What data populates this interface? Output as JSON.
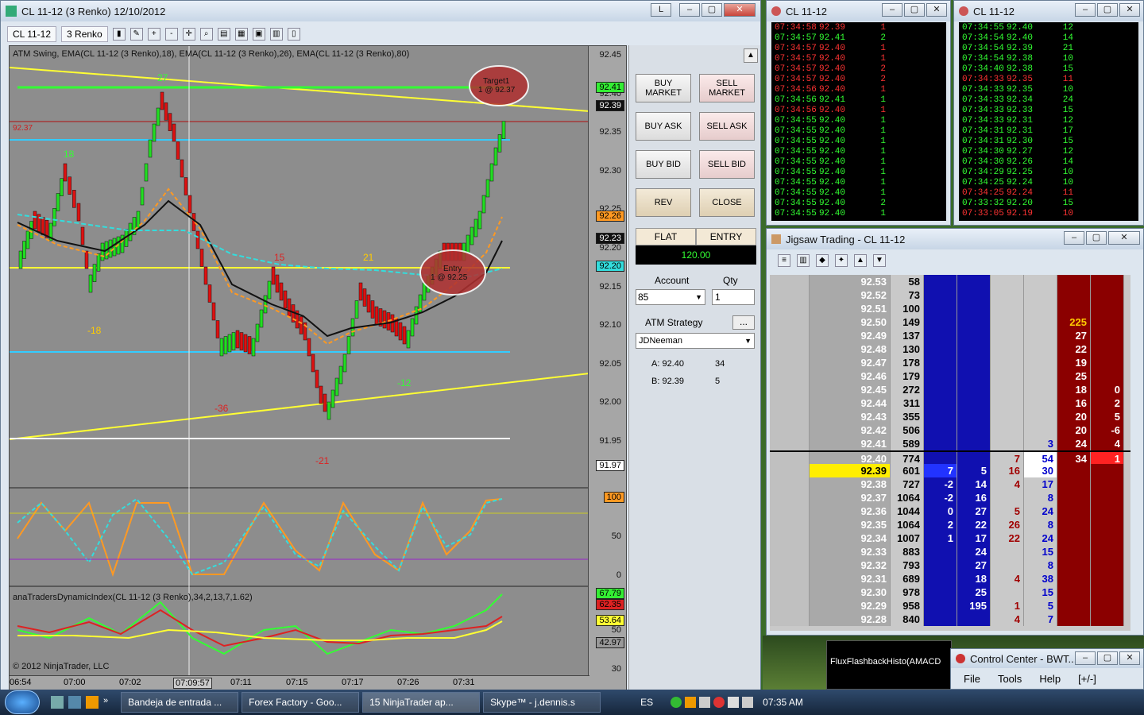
{
  "chart_window": {
    "title": "CL 11-12 (3 Renko)  12/10/2012",
    "mode_btn": "L",
    "instrument": "CL 11-12",
    "period": "3 Renko",
    "indicator_label": "ATM Swing, EMA(CL 11-12 (3 Renko),18), EMA(CL 11-12 (3 Renko),26), EMA(CL 11-12 (3 Renko),80)",
    "lower_label": "anaTradersDynamicIndex(CL 11-12 (3 Renko),34,2,13,7,1.62)",
    "copyright": "© 2012 NinjaTrader, LLC",
    "yticks": [
      "92.45",
      "92.40",
      "92.35",
      "92.30",
      "92.25",
      "92.20",
      "92.15",
      "92.10",
      "92.05",
      "92.00",
      "91.95"
    ],
    "tags": {
      "t1": "92.41",
      "t2": "92.39",
      "t3": "92.26",
      "t4": "92.23",
      "t5": "92.20",
      "t6": "91.97"
    },
    "osc_ticks": [
      "100",
      "50",
      "0"
    ],
    "tdi_ticks": [
      "90",
      "70",
      "50",
      "30"
    ],
    "tdi_tags": [
      "67.79",
      "62.35",
      "53.64",
      "42.97"
    ],
    "xticks": [
      "06:54",
      "07:00",
      "07:02",
      "07:09:57",
      "07:11",
      "07:15",
      "07:17",
      "07:26",
      "07:31"
    ],
    "swing_labels": [
      "27",
      "18",
      "-18",
      "15",
      "21",
      "-36",
      "-21",
      "-12"
    ],
    "target": "Target1",
    "target_qty": "1 @ 92.37",
    "entry": "Entry",
    "entry_qty": "1 @ 92.25",
    "left_price": "92.37"
  },
  "order_panel": {
    "buy_market": "BUY MARKET",
    "sell_market": "SELL MARKET",
    "buy_ask": "BUY ASK",
    "sell_ask": "SELL ASK",
    "buy_bid": "BUY BID",
    "sell_bid": "SELL BID",
    "rev": "REV",
    "close": "CLOSE",
    "flat": "FLAT",
    "entry": "ENTRY",
    "position": "120.00",
    "account_label": "Account",
    "qty_label": "Qty",
    "account_value": "85",
    "qty_value": "1",
    "atm_label": "ATM Strategy",
    "atm_btn": "...",
    "atm_value": "JDNeeman",
    "ask_label": "A: 92.40",
    "ask_size": "34",
    "bid_label": "B: 92.39",
    "bid_size": "5"
  },
  "ts1": {
    "title": "CL 11-12",
    "rows": [
      [
        "07:34:58",
        "92.39",
        "1",
        "r"
      ],
      [
        "07:34:57",
        "92.41",
        "2",
        "g"
      ],
      [
        "07:34:57",
        "92.40",
        "1",
        "r"
      ],
      [
        "07:34:57",
        "92.40",
        "1",
        "r"
      ],
      [
        "07:34:57",
        "92.40",
        "2",
        "r"
      ],
      [
        "07:34:57",
        "92.40",
        "2",
        "r"
      ],
      [
        "07:34:56",
        "92.40",
        "1",
        "r"
      ],
      [
        "07:34:56",
        "92.41",
        "1",
        "g"
      ],
      [
        "07:34:56",
        "92.40",
        "1",
        "r"
      ],
      [
        "07:34:55",
        "92.40",
        "1",
        "g"
      ],
      [
        "07:34:55",
        "92.40",
        "1",
        "g"
      ],
      [
        "07:34:55",
        "92.40",
        "1",
        "g"
      ],
      [
        "07:34:55",
        "92.40",
        "1",
        "g"
      ],
      [
        "07:34:55",
        "92.40",
        "1",
        "g"
      ],
      [
        "07:34:55",
        "92.40",
        "1",
        "g"
      ],
      [
        "07:34:55",
        "92.40",
        "1",
        "g"
      ],
      [
        "07:34:55",
        "92.40",
        "1",
        "g"
      ],
      [
        "07:34:55",
        "92.40",
        "2",
        "g"
      ],
      [
        "07:34:55",
        "92.40",
        "1",
        "g"
      ]
    ]
  },
  "ts2": {
    "title": "CL 11-12",
    "rows": [
      [
        "07:34:55",
        "92.40",
        "12",
        "g"
      ],
      [
        "07:34:54",
        "92.40",
        "14",
        "g"
      ],
      [
        "07:34:54",
        "92.39",
        "21",
        "g"
      ],
      [
        "07:34:54",
        "92.38",
        "10",
        "g"
      ],
      [
        "07:34:40",
        "92.38",
        "15",
        "g"
      ],
      [
        "07:34:33",
        "92.35",
        "11",
        "r"
      ],
      [
        "07:34:33",
        "92.35",
        "10",
        "g"
      ],
      [
        "07:34:33",
        "92.34",
        "24",
        "g"
      ],
      [
        "07:34:33",
        "92.33",
        "15",
        "g"
      ],
      [
        "07:34:33",
        "92.31",
        "12",
        "g"
      ],
      [
        "07:34:31",
        "92.31",
        "17",
        "g"
      ],
      [
        "07:34:31",
        "92.30",
        "15",
        "g"
      ],
      [
        "07:34:30",
        "92.27",
        "12",
        "g"
      ],
      [
        "07:34:30",
        "92.26",
        "14",
        "g"
      ],
      [
        "07:34:29",
        "92.25",
        "10",
        "g"
      ],
      [
        "07:34:25",
        "92.24",
        "10",
        "g"
      ],
      [
        "07:34:25",
        "92.24",
        "11",
        "r"
      ],
      [
        "07:33:32",
        "92.20",
        "15",
        "g"
      ],
      [
        "07:33:05",
        "92.19",
        "10",
        "r"
      ]
    ]
  },
  "ladder": {
    "title": "Jigsaw Trading - CL 11-12",
    "rows": [
      [
        "",
        "92.53",
        "58",
        "",
        "",
        "",
        "",
        "",
        ""
      ],
      [
        "",
        "92.52",
        "73",
        "",
        "",
        "",
        "",
        "",
        ""
      ],
      [
        "",
        "92.51",
        "100",
        "",
        "",
        "",
        "",
        "",
        ""
      ],
      [
        "",
        "92.50",
        "149",
        "",
        "",
        "",
        "",
        "225",
        ""
      ],
      [
        "",
        "92.49",
        "137",
        "",
        "",
        "",
        "",
        "27",
        ""
      ],
      [
        "",
        "92.48",
        "130",
        "",
        "",
        "",
        "",
        "22",
        ""
      ],
      [
        "",
        "92.47",
        "178",
        "",
        "",
        "",
        "",
        "19",
        ""
      ],
      [
        "",
        "92.46",
        "179",
        "",
        "",
        "",
        "",
        "25",
        ""
      ],
      [
        "",
        "92.45",
        "272",
        "",
        "",
        "",
        "",
        "18",
        "0"
      ],
      [
        "",
        "92.44",
        "311",
        "",
        "",
        "",
        "",
        "16",
        "2"
      ],
      [
        "",
        "92.43",
        "355",
        "",
        "",
        "",
        "",
        "20",
        "5"
      ],
      [
        "",
        "92.42",
        "506",
        "",
        "",
        "",
        "",
        "20",
        "-6"
      ],
      [
        "",
        "92.41",
        "589",
        "",
        "",
        "",
        "3",
        "24",
        "4"
      ],
      [
        "",
        "92.40",
        "774",
        "",
        "",
        "7",
        "54",
        "34",
        "1"
      ],
      [
        "",
        "92.39",
        "601",
        "7",
        "5",
        "16",
        "30",
        "",
        ""
      ],
      [
        "",
        "92.38",
        "727",
        "-2",
        "14",
        "4",
        "17",
        "",
        ""
      ],
      [
        "",
        "92.37",
        "1064",
        "-2",
        "16",
        "",
        "8",
        "",
        ""
      ],
      [
        "",
        "92.36",
        "1044",
        "0",
        "27",
        "5",
        "24",
        "",
        ""
      ],
      [
        "",
        "92.35",
        "1064",
        "2",
        "22",
        "26",
        "8",
        "",
        ""
      ],
      [
        "",
        "92.34",
        "1007",
        "1",
        "17",
        "22",
        "24",
        "",
        ""
      ],
      [
        "",
        "92.33",
        "883",
        "",
        "24",
        "",
        "15",
        "",
        ""
      ],
      [
        "",
        "92.32",
        "793",
        "",
        "27",
        "",
        "8",
        "",
        ""
      ],
      [
        "",
        "92.31",
        "689",
        "",
        "18",
        "4",
        "38",
        "",
        ""
      ],
      [
        "",
        "92.30",
        "978",
        "",
        "25",
        "",
        "15",
        "",
        ""
      ],
      [
        "",
        "92.29",
        "958",
        "",
        "195",
        "1",
        "5",
        "",
        ""
      ],
      [
        "",
        "92.28",
        "840",
        "",
        "",
        "4",
        "7",
        "",
        ""
      ]
    ]
  },
  "flux": "FluxFlashbackHisto(AMACD",
  "control_center": {
    "title": "Control Center - BWT...",
    "menu": [
      "File",
      "Tools",
      "Help",
      "[+/-]"
    ]
  },
  "taskbar": {
    "items": [
      "Bandeja de entrada ...",
      "Forex Factory - Goo...",
      "15 NinjaTrader ap...",
      "Skype™ - j.dennis.s"
    ],
    "lang": "ES",
    "clock": "07:35 AM"
  }
}
